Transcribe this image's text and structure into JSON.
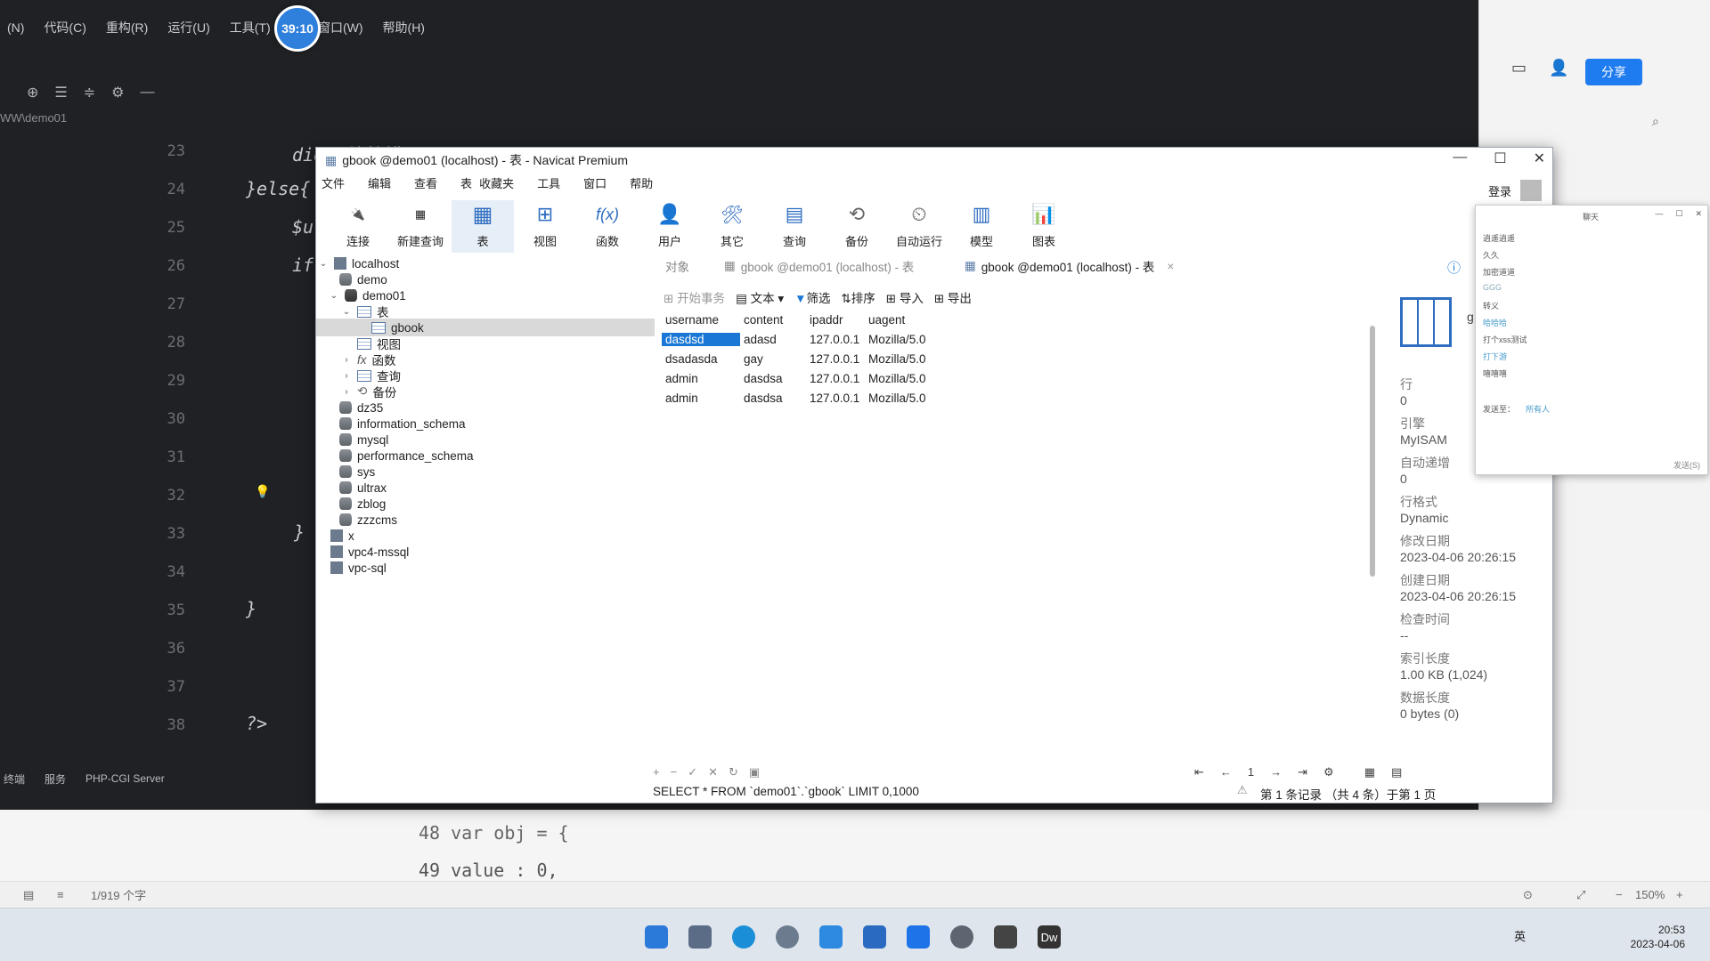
{
  "ide": {
    "menu": [
      "(N)",
      "代码(C)",
      "重构(R)",
      "运行(U)",
      "工具(T)",
      "V",
      "窗口(W)",
      "帮助(H)"
    ],
    "path": "WW\\demo01",
    "line_numbers": [
      "23",
      "24",
      "25",
      "26",
      "27",
      "28",
      "29",
      "30",
      "31",
      "32",
      "33",
      "34",
      "35",
      "36",
      "37",
      "38"
    ],
    "code_lines": {
      "l23": "die(\"连接错误\" . mysqli_connect_error());",
      "l24": "}else{",
      "l25": "$u",
      "l26": "if",
      "l33": "}",
      "l35": "}",
      "l38": "?>"
    },
    "status": [
      "终端",
      "服务",
      "PHP-CGI Server"
    ]
  },
  "timer": "39:10",
  "right_app": {
    "share_label": "分享",
    "zoom": "150%",
    "word_count": "1/919 个字"
  },
  "doc_strip": {
    "line48": "48    var obj = {",
    "line49": "49        value : 0,"
  },
  "navicat": {
    "title": "gbook @demo01 (localhost) - 表 - Navicat Premium",
    "menu": [
      "文件",
      "编辑",
      "查看",
      "表",
      "收藏夹",
      "工具",
      "窗口",
      "帮助"
    ],
    "login": "登录",
    "toolbar": [
      {
        "label": "连接",
        "icon": "connect-icon"
      },
      {
        "label": "新建查询",
        "icon": "new-query-icon"
      },
      {
        "label": "表",
        "icon": "table-icon"
      },
      {
        "label": "视图",
        "icon": "view-icon"
      },
      {
        "label": "函数",
        "icon": "function-icon"
      },
      {
        "label": "用户",
        "icon": "user-icon"
      },
      {
        "label": "其它",
        "icon": "other-icon"
      },
      {
        "label": "查询",
        "icon": "query-icon"
      },
      {
        "label": "备份",
        "icon": "backup-icon"
      },
      {
        "label": "自动运行",
        "icon": "schedule-icon"
      },
      {
        "label": "模型",
        "icon": "model-icon"
      },
      {
        "label": "图表",
        "icon": "chart-icon"
      }
    ],
    "tree": {
      "localhost": "localhost",
      "demo": "demo",
      "demo01": "demo01",
      "tables": "表",
      "gbook": "gbook",
      "views": "视图",
      "functions": "函数",
      "queries": "查询",
      "backups": "备份",
      "dbs": [
        "dz35",
        "information_schema",
        "mysql",
        "performance_schema",
        "sys",
        "ultrax",
        "zblog",
        "zzzcms"
      ],
      "connections": [
        "x",
        "vpc4-mssql",
        "vpc-sql"
      ]
    },
    "tabs": [
      "对象",
      "gbook @demo01 (localhost) - 表",
      "gbook @demo01 (localhost) - 表"
    ],
    "data_toolbar": [
      "开始事务",
      "文本",
      "筛选",
      "排序",
      "导入",
      "导出"
    ],
    "grid": {
      "columns": [
        "username",
        "content",
        "ipaddr",
        "uagent"
      ],
      "rows": [
        [
          "dasdsd",
          "adasd",
          "127.0.0.1",
          "Mozilla/5.0"
        ],
        [
          "dsadasda",
          "gay",
          "127.0.0.1",
          "Mozilla/5.0"
        ],
        [
          "admin",
          "dasdsa",
          "127.0.0.1",
          "Mozilla/5.0"
        ],
        [
          "admin",
          "dasdsa",
          "127.0.0.1",
          "Mozilla/5.0"
        ]
      ]
    },
    "info": {
      "name": "g",
      "rows_label": "行",
      "rows_value": "0",
      "engine_label": "引擎",
      "engine_value": "MyISAM",
      "autoinc_label": "自动递增",
      "autoinc_value": "0",
      "rowformat_label": "行格式",
      "rowformat_value": "Dynamic",
      "modified_label": "修改日期",
      "modified_value": "2023-04-06 20:26:15",
      "created_label": "创建日期",
      "created_value": "2023-04-06 20:26:15",
      "checktime_label": "检查时间",
      "checktime_value": "--",
      "indexlen_label": "索引长度",
      "indexlen_value": "1.00 KB (1,024)",
      "datalen_label": "数据长度",
      "datalen_value": "0 bytes (0)"
    },
    "sql": "SELECT * FROM `demo01`.`gbook` LIMIT 0,1000",
    "page": "1",
    "record_status": "第 1 条记录 （共 4 条）于第 1 页"
  },
  "chat": {
    "title": "聊天",
    "messages": [
      "逍遥逍遥",
      "久久",
      "加密道道",
      "GGG",
      "转义",
      "哈哈哈",
      "打个xss测试",
      "打下游",
      "嘻嘻嘻"
    ],
    "send_to": "发送至：",
    "recipient": "所有人",
    "send": "发送(S)"
  },
  "taskbar": {
    "time": "20:53",
    "date": "2023-04-06",
    "ime": "英"
  },
  "colors": {
    "accent": "#1a77d6",
    "share": "#1e7cf0",
    "ide_bg": "#1f2124"
  }
}
